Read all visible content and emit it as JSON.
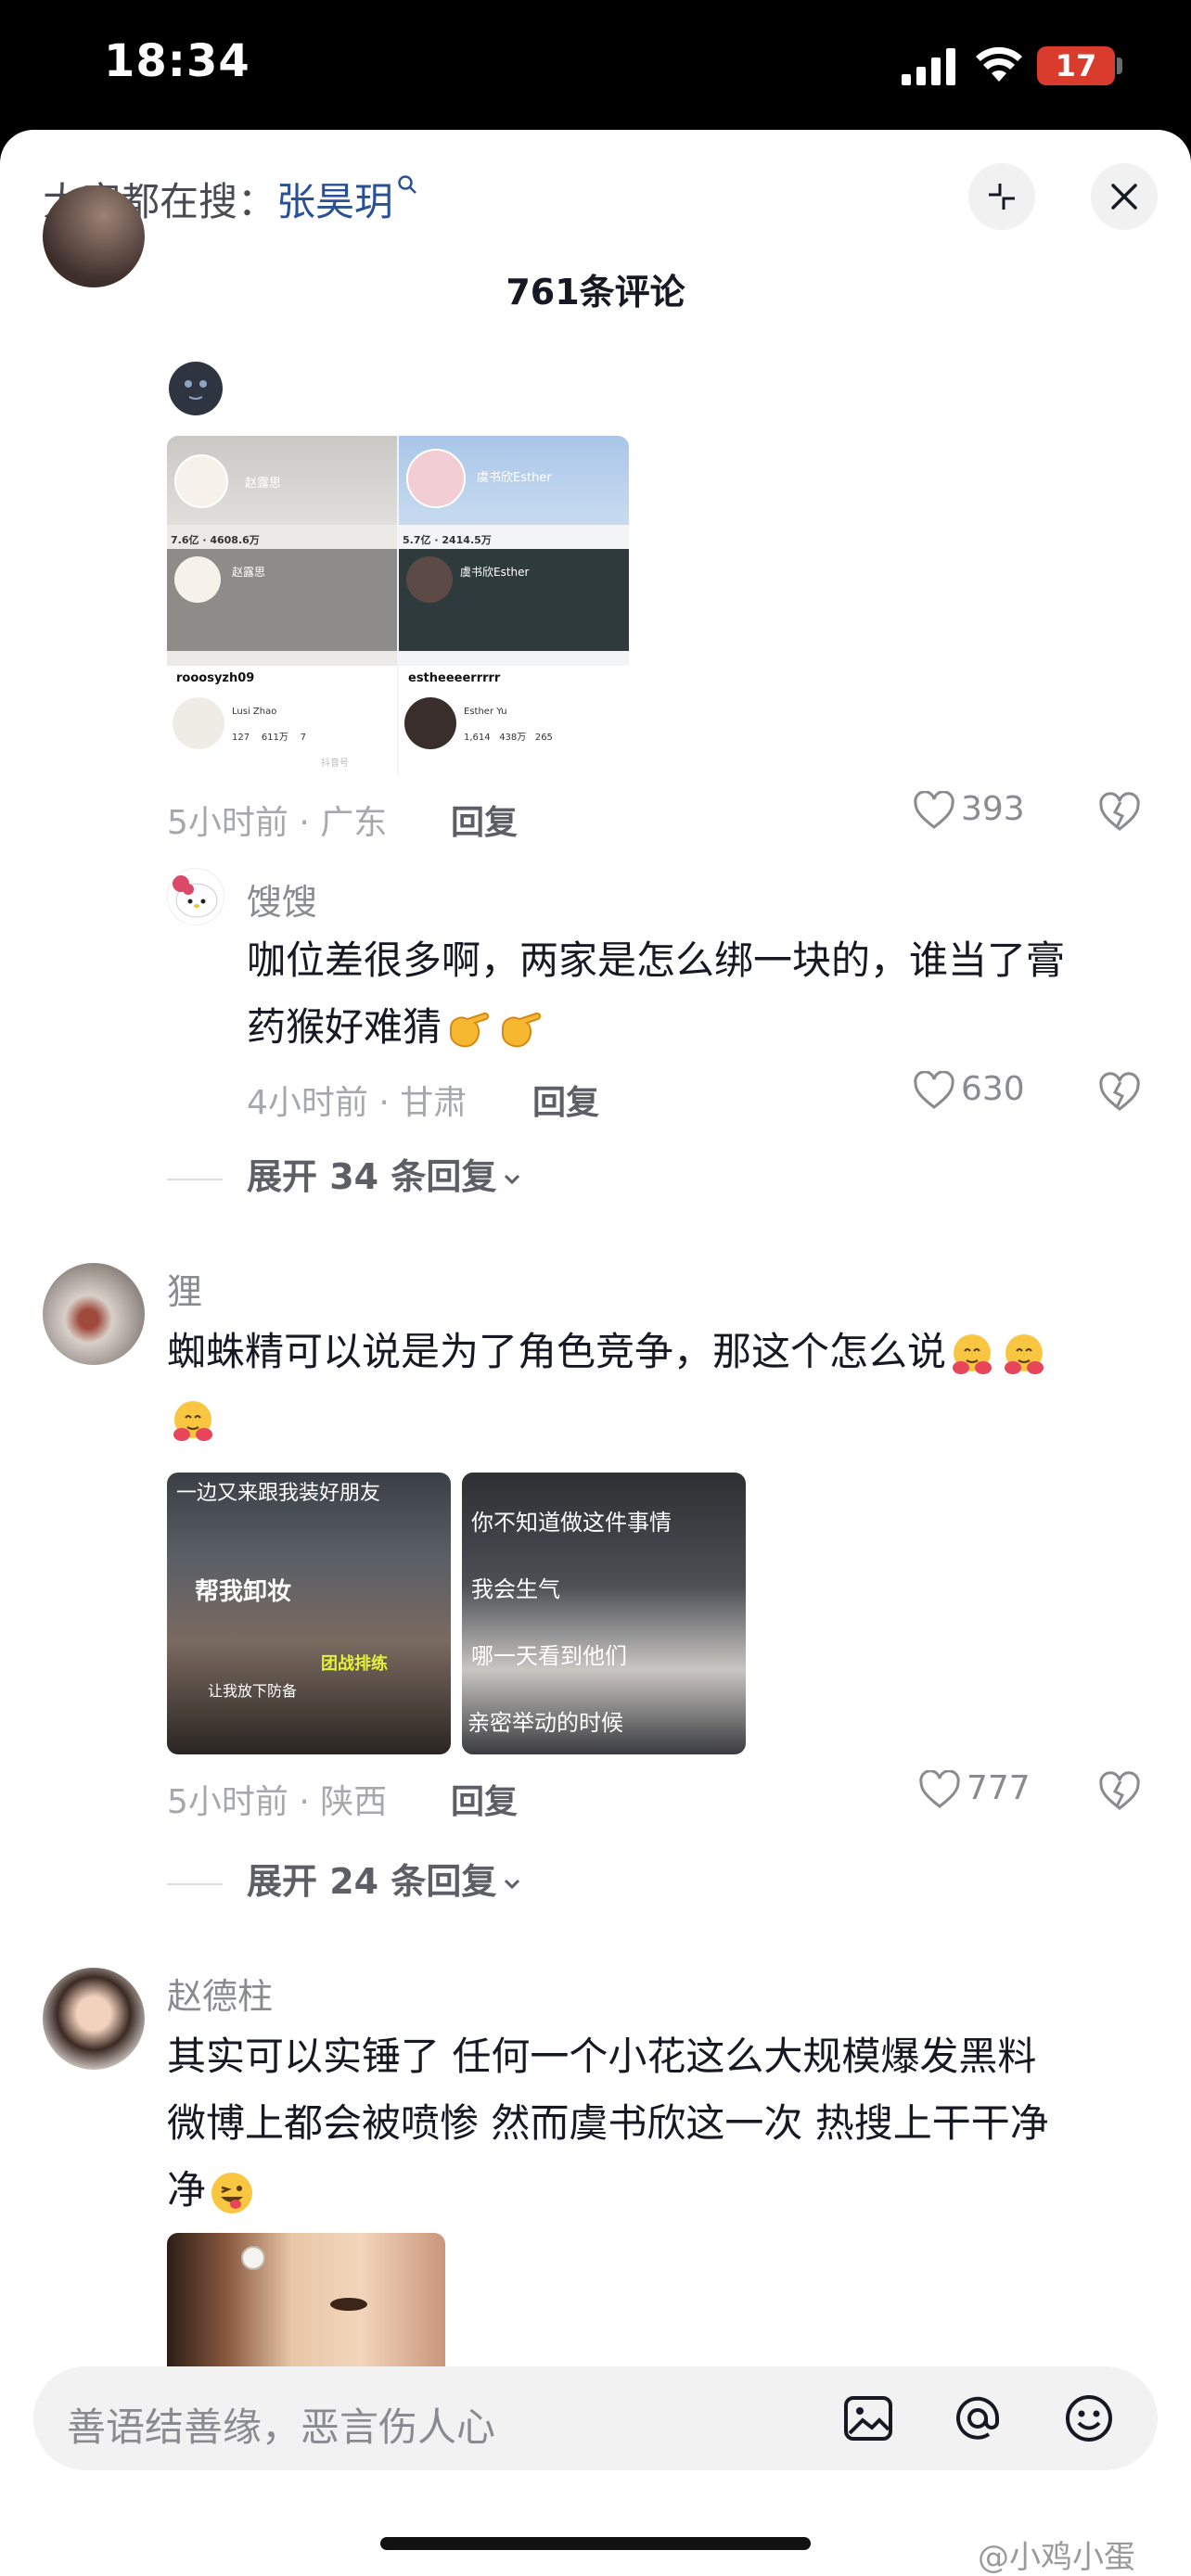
{
  "status_bar": {
    "time": "18:34",
    "battery": "17"
  },
  "header": {
    "hot_search_prefix": "大家都在搜：",
    "hot_search_keyword": "张昊玥",
    "comment_count": "761条评论"
  },
  "comments": [
    {
      "meta": "5小时前 · 广东",
      "reply": "回复",
      "likes": "393"
    },
    {
      "username": "馊馊",
      "text_line1": "咖位差很多啊，两家是怎么绑一块的，谁当了膏",
      "text_line2": "药猴好难猜",
      "meta": "4小时前 · 甘肃",
      "reply": "回复",
      "likes": "630",
      "expand": "展开 34 条回复"
    },
    {
      "username": "狸",
      "text_line1": "蜘蛛精可以说是为了角色竞争，那这个怎么说",
      "meta": "5小时前 · 陕西",
      "reply": "回复",
      "likes": "777",
      "expand": "展开 24 条回复"
    },
    {
      "username": "赵德柱",
      "text_line1": "其实可以实锤了 任何一个小花这么大规模爆发黑料",
      "text_line2": "微博上都会被喷惨 然而虞书欣这一次 热搜上干干净",
      "text_line3": "净"
    }
  ],
  "screenshot_image": {
    "left_name": "赵露思",
    "left_stats": "7.6亿",
    "left_stat2": "4608.6万",
    "left_handle": "rooosyzh09",
    "left_sub": "Lusi Zhao",
    "left_nums": [
      "127",
      "611万",
      "7"
    ],
    "right_name": "虞书欣Esther",
    "right_stats": "5.7亿",
    "right_stat2": "2414.5万",
    "right_handle": "estheeeerrrrr",
    "right_sub": "Esther Yu",
    "right_nums": [
      "1,614",
      "438万",
      "265"
    ],
    "watermark": "抖音号"
  },
  "meme_captions": {
    "left_top": "一边又来跟我装好朋友",
    "left_mid": "帮我卸妆",
    "left_tag": "团战排练",
    "left_sub": "让我放下防备",
    "right_1": "你不知道做这件事情",
    "right_2": "我会生气",
    "right_3": "哪一天看到他们",
    "right_4": "亲密举动的时候"
  },
  "input": {
    "placeholder": "善语结善缘，恶言伤人心"
  },
  "watermark": "@小鸡小蛋",
  "colors": {
    "link": "#2a5196",
    "battery": "#d93b2c"
  }
}
